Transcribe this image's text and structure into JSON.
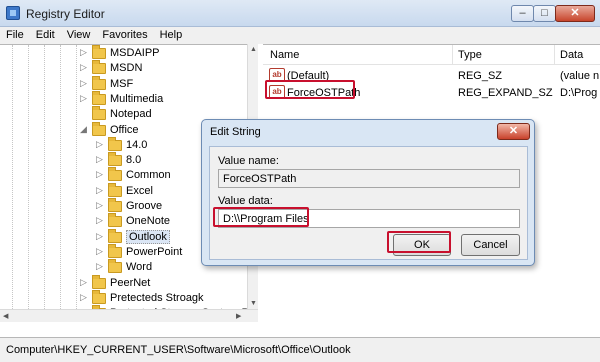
{
  "window": {
    "title": "Registry Editor",
    "minimize": "–",
    "maximize": "□",
    "close": "✕"
  },
  "menu": [
    "File",
    "Edit",
    "View",
    "Favorites",
    "Help"
  ],
  "tree": {
    "items": [
      {
        "label": "MSDAIPP",
        "level": 0,
        "expander": "▷"
      },
      {
        "label": "MSDN",
        "level": 0,
        "expander": "▷"
      },
      {
        "label": "MSF",
        "level": 0,
        "expander": "▷"
      },
      {
        "label": "Multimedia",
        "level": 0,
        "expander": "▷"
      },
      {
        "label": "Notepad",
        "level": 0,
        "expander": ""
      },
      {
        "label": "Office",
        "level": 0,
        "expander": "◢"
      },
      {
        "label": "14.0",
        "level": 1,
        "expander": "▷"
      },
      {
        "label": "8.0",
        "level": 1,
        "expander": "▷"
      },
      {
        "label": "Common",
        "level": 1,
        "expander": "▷"
      },
      {
        "label": "Excel",
        "level": 1,
        "expander": "▷"
      },
      {
        "label": "Groove",
        "level": 1,
        "expander": "▷"
      },
      {
        "label": "OneNote",
        "level": 1,
        "expander": "▷"
      },
      {
        "label": "Outlook",
        "level": 1,
        "expander": "▷",
        "selected": true
      },
      {
        "label": "PowerPoint",
        "level": 1,
        "expander": "▷"
      },
      {
        "label": "Word",
        "level": 1,
        "expander": "▷"
      },
      {
        "label": "PeerNet",
        "level": 0,
        "expander": "▷"
      },
      {
        "label": "Pretecteds Stroagk",
        "level": 0,
        "expander": "▷"
      },
      {
        "label": "Protected Storage System Prov",
        "level": 0,
        "expander": "▷"
      }
    ]
  },
  "list": {
    "columns": [
      "Name",
      "Type",
      "Data"
    ],
    "rows": [
      {
        "icon": "ab",
        "name": "(Default)",
        "type": "REG_SZ",
        "data": "(value n"
      },
      {
        "icon": "ab",
        "name": "ForceOSTPath",
        "type": "REG_EXPAND_SZ",
        "data": "D:\\Prog"
      }
    ]
  },
  "status": {
    "path": "Computer\\HKEY_CURRENT_USER\\Software\\Microsoft\\Office\\Outlook"
  },
  "dialog": {
    "title": "Edit String",
    "close": "✕",
    "value_name_label": "Value name:",
    "value_name": "ForceOSTPath",
    "value_data_label": "Value data:",
    "value_data": "D:\\\\Program Files",
    "ok_label": "OK",
    "cancel_label": "Cancel"
  },
  "colors": {
    "highlight": "#c8102e",
    "selection": "#dbe6f5"
  },
  "icons": {
    "app": "registry-editor-icon",
    "folder": "folder-icon",
    "string_value": "string-value-icon"
  }
}
